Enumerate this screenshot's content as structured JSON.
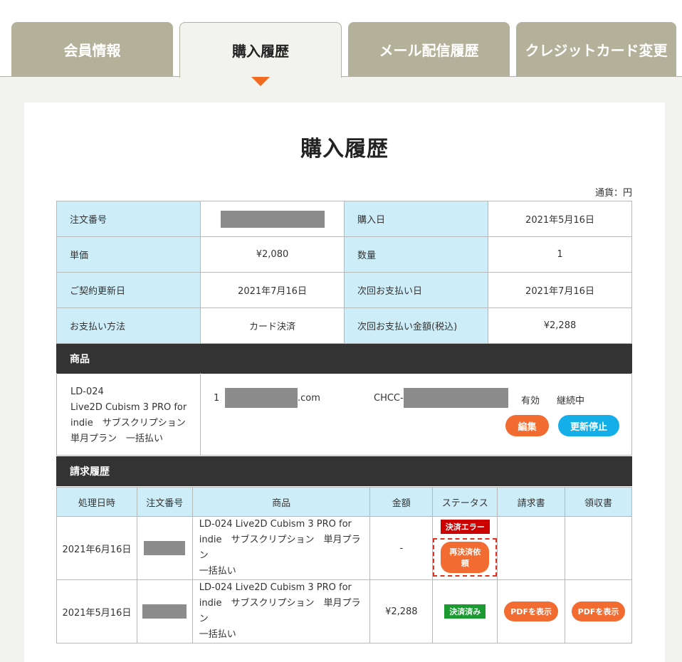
{
  "tabs": [
    {
      "label": "会員情報",
      "active": false
    },
    {
      "label": "購入履歴",
      "active": true
    },
    {
      "label": "メール配信履歴",
      "active": false
    },
    {
      "label": "クレジットカード変更",
      "active": false
    }
  ],
  "page": {
    "title": "購入履歴",
    "currency_note": "通貨：円"
  },
  "order_info": {
    "order_number_label": "注文番号",
    "purchase_date_label": "購入日",
    "purchase_date": "2021年5月16日",
    "unit_price_label": "単価",
    "unit_price": "¥2,080",
    "quantity_label": "数量",
    "quantity": "1",
    "renewal_date_label": "ご契約更新日",
    "renewal_date": "2021年7月16日",
    "next_payment_date_label": "次回お支払い日",
    "next_payment_date": "2021年7月16日",
    "payment_method_label": "お支払い方法",
    "payment_method": "カード決済",
    "next_payment_amount_label": "次回お支払い金額(税込)",
    "next_payment_amount": "¥2,288"
  },
  "product_section": {
    "heading": "商品",
    "name_lines": [
      "LD-024",
      "Live2D Cubism 3 PRO for",
      "indie　サブスクリプション",
      "単月プラン　一括払い"
    ],
    "count": "1",
    "email_suffix": ".com",
    "license_prefix": "CHCC-",
    "state": "有効",
    "renewal_state": "継続中",
    "edit_button": "編集",
    "stop_renewal_button": "更新停止"
  },
  "billing_section": {
    "heading": "請求履歴",
    "columns": [
      "処理日時",
      "注文番号",
      "商品",
      "金額",
      "ステータス",
      "請求書",
      "領収書"
    ],
    "rows": [
      {
        "date": "2021年6月16日",
        "product_lines": [
          "LD-024 Live2D Cubism 3 PRO for",
          "indie　サブスクリプション　単月プラン",
          "一括払い"
        ],
        "amount": "-",
        "status": "決済エラー",
        "action": "再決済依頼"
      },
      {
        "date": "2021年5月16日",
        "product_lines": [
          "LD-024 Live2D Cubism 3 PRO for",
          "indie　サブスクリプション　単月プラン",
          "一括払い"
        ],
        "amount": "¥2,288",
        "status": "決済済み",
        "invoice": "PDFを表示",
        "receipt": "PDFを表示"
      }
    ]
  },
  "colors": {
    "tab_inactive": "#b3b19a",
    "accent_orange": "#f26b30",
    "accent_blue": "#14aee8",
    "label_bg": "#cdeef9",
    "dark_header": "#333333",
    "error_red": "#cc0000",
    "success_green": "#1a9a30"
  }
}
